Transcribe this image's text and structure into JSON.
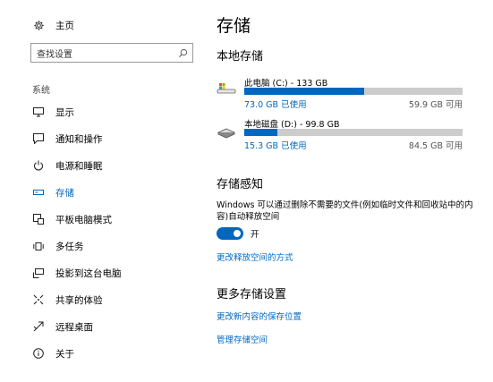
{
  "sidebar": {
    "home_label": "主页",
    "search_placeholder": "查找设置",
    "group_title": "系统",
    "items": [
      {
        "label": "显示",
        "icon": "monitor-icon"
      },
      {
        "label": "通知和操作",
        "icon": "notification-icon"
      },
      {
        "label": "电源和睡眠",
        "icon": "power-icon"
      },
      {
        "label": "存储",
        "icon": "storage-icon",
        "selected": true
      },
      {
        "label": "平板电脑模式",
        "icon": "tablet-mode-icon"
      },
      {
        "label": "多任务",
        "icon": "multitasking-icon"
      },
      {
        "label": "投影到这台电脑",
        "icon": "projecting-icon"
      },
      {
        "label": "共享的体验",
        "icon": "shared-experiences-icon"
      },
      {
        "label": "远程桌面",
        "icon": "remote-desktop-icon"
      },
      {
        "label": "关于",
        "icon": "info-icon"
      }
    ]
  },
  "main": {
    "title": "存储",
    "local_storage": {
      "heading": "本地存储",
      "drives": [
        {
          "name": "此电脑 (C:) - 133 GB",
          "used": "73.0 GB 已使用",
          "free": "59.9 GB 可用",
          "used_fraction": 0.549,
          "icon": "this-pc-drive-icon"
        },
        {
          "name": "本地磁盘 (D:) - 99.8 GB",
          "used": "15.3 GB 已使用",
          "free": "84.5 GB 可用",
          "used_fraction": 0.153,
          "icon": "local-disk-icon"
        }
      ]
    },
    "storage_sense": {
      "heading": "存储感知",
      "description": "Windows 可以通过删除不需要的文件(例如临时文件和回收站中的内容)自动释放空间",
      "toggle_state": "开",
      "toggle_on": true,
      "link": "更改释放空间的方式"
    },
    "more_settings": {
      "heading": "更多存储设置",
      "links": [
        "更改新内容的保存位置",
        "管理存储空间"
      ]
    }
  },
  "colors": {
    "accent": "#0067c0",
    "bar_track": "#cccccc"
  }
}
